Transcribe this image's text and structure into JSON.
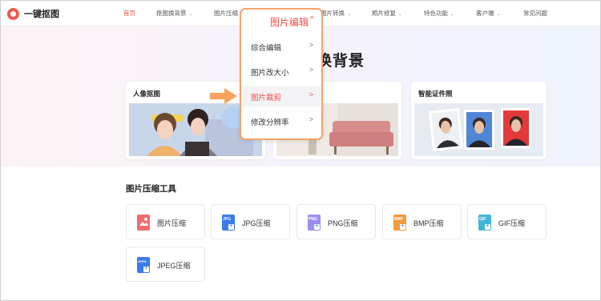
{
  "logo": {
    "text": "一键抠图"
  },
  "nav": {
    "items": [
      {
        "label": "首页",
        "chevron": ""
      },
      {
        "label": "抠图换背景",
        "chevron": "⌄"
      },
      {
        "label": "图片压缩",
        "chevron": ""
      },
      {
        "label": "图片转换",
        "chevron": "⌄"
      },
      {
        "label": "照片修复",
        "chevron": "⌄"
      },
      {
        "label": "特色功能",
        "chevron": "⌄"
      },
      {
        "label": "客户端",
        "chevron": "⌄"
      },
      {
        "label": "常见问题",
        "chevron": ""
      }
    ]
  },
  "hero": {
    "title": "图换背景",
    "cards": [
      {
        "title": "人像抠图"
      },
      {
        "title": "智能证件照"
      }
    ]
  },
  "dropdown": {
    "header": "图片编辑",
    "header_chevron": "^",
    "items": [
      {
        "label": "综合编辑",
        "arrow": ">"
      },
      {
        "label": "图片改大小",
        "arrow": ">"
      },
      {
        "label": "图片裁剪",
        "arrow": ">"
      },
      {
        "label": "修改分辨率",
        "arrow": ">"
      }
    ]
  },
  "tools": {
    "title": "图片压缩工具",
    "items": [
      {
        "label": "图片压缩",
        "icon": "image-compress-icon",
        "badge": "",
        "color": "#f26b6b"
      },
      {
        "label": "JPG压缩",
        "icon": "jpg-file-icon",
        "badge": "JPG",
        "color": "#3a7be8"
      },
      {
        "label": "PNG压缩",
        "icon": "png-file-icon",
        "badge": "PNG",
        "color": "#9d8df0"
      },
      {
        "label": "BMP压缩",
        "icon": "bmp-file-icon",
        "badge": "BMP",
        "color": "#f59a3c"
      },
      {
        "label": "GIF压缩",
        "icon": "gif-file-icon",
        "badge": "GIF",
        "color": "#3fb5d9"
      },
      {
        "label": "JPEG压缩",
        "icon": "jpeg-file-icon",
        "badge": "JPEG",
        "color": "#3a7be8"
      }
    ]
  },
  "colors": {
    "accent": "#ef4b48",
    "highlight_border": "#f6a46a",
    "arrow": "#f7a35c"
  }
}
